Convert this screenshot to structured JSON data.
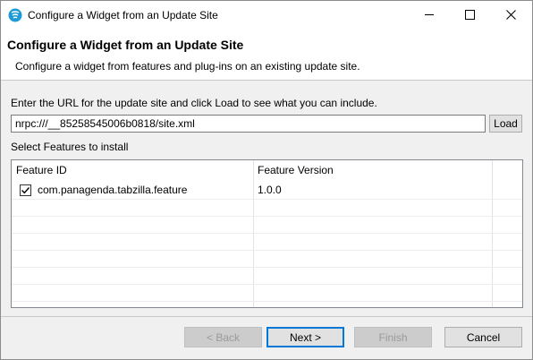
{
  "window": {
    "title": "Configure a Widget from an Update Site",
    "icon": "swirl-app-icon"
  },
  "header": {
    "title": "Configure a Widget from an Update Site",
    "description": "Configure a widget from features and plug-ins on an existing update site."
  },
  "form": {
    "url_prompt": "Enter the URL for the update site and click Load to see what you can include.",
    "url_value": "nrpc:///__85258545006b0818/site.xml",
    "load_label": "Load",
    "select_label": "Select Features to install"
  },
  "table": {
    "columns": [
      "Feature ID",
      "Feature Version"
    ],
    "rows": [
      {
        "feature_id": "com.panagenda.tabzilla.feature",
        "version": "1.0.0",
        "checked": true
      }
    ]
  },
  "buttons": {
    "back": "< Back",
    "next": "Next >",
    "finish": "Finish",
    "cancel": "Cancel"
  },
  "colors": {
    "default_button_border": "#0078d7",
    "disabled_text": "#9a9a9a"
  }
}
